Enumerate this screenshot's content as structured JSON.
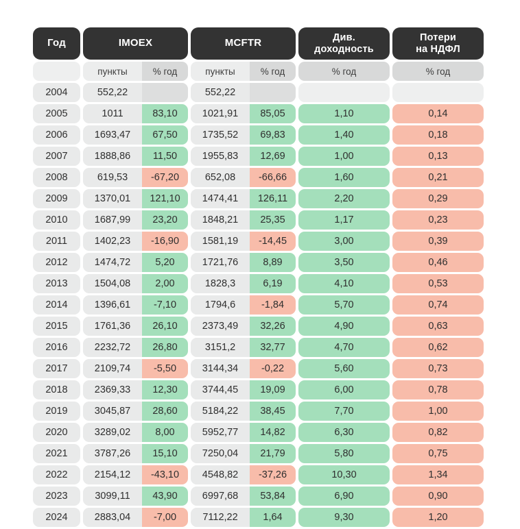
{
  "table": {
    "headers": [
      {
        "label": "Год",
        "sub": ""
      },
      {
        "label": "IMOEX",
        "sub_points": "пункты",
        "sub_pct": "% год"
      },
      {
        "label": "MCFTR",
        "sub_points": "пункты",
        "sub_pct": "% год"
      },
      {
        "label": "Див.\nдоходность",
        "line1": "Див.",
        "line2": "доходность",
        "sub": "% год"
      },
      {
        "label": "Потери\nна НДФЛ",
        "line1": "Потери",
        "line2": "на НДФЛ",
        "sub": "% год"
      }
    ],
    "colors": {
      "header_bg": "#333333",
      "header_text": "#ffffff",
      "cell_bg": "#e9eaea",
      "sub_bg": "#eceded",
      "sub_shade": "#d8d9d9",
      "positive": "#a4dfbb",
      "negative": "#f8bcaa",
      "empty": "#dddede",
      "text": "#2f2f2f",
      "page_bg": "#ffffff"
    },
    "rows": [
      {
        "year": "2004",
        "imoex_pts": "552,22",
        "imoex_pct": "",
        "imoex_sign": "empty",
        "mcftr_pts": "552,22",
        "mcftr_pct": "",
        "mcftr_sign": "empty",
        "div": "",
        "div_sign": "empty",
        "ndfl": "",
        "ndfl_sign": "empty"
      },
      {
        "year": "2005",
        "imoex_pts": "1011",
        "imoex_pct": "83,10",
        "imoex_sign": "pos",
        "mcftr_pts": "1021,91",
        "mcftr_pct": "85,05",
        "mcftr_sign": "pos",
        "div": "1,10",
        "div_sign": "pos",
        "ndfl": "0,14",
        "ndfl_sign": "neg"
      },
      {
        "year": "2006",
        "imoex_pts": "1693,47",
        "imoex_pct": "67,50",
        "imoex_sign": "pos",
        "mcftr_pts": "1735,52",
        "mcftr_pct": "69,83",
        "mcftr_sign": "pos",
        "div": "1,40",
        "div_sign": "pos",
        "ndfl": "0,18",
        "ndfl_sign": "neg"
      },
      {
        "year": "2007",
        "imoex_pts": "1888,86",
        "imoex_pct": "11,50",
        "imoex_sign": "pos",
        "mcftr_pts": "1955,83",
        "mcftr_pct": "12,69",
        "mcftr_sign": "pos",
        "div": "1,00",
        "div_sign": "pos",
        "ndfl": "0,13",
        "ndfl_sign": "neg"
      },
      {
        "year": "2008",
        "imoex_pts": "619,53",
        "imoex_pct": "-67,20",
        "imoex_sign": "neg",
        "mcftr_pts": "652,08",
        "mcftr_pct": "-66,66",
        "mcftr_sign": "neg",
        "div": "1,60",
        "div_sign": "pos",
        "ndfl": "0,21",
        "ndfl_sign": "neg"
      },
      {
        "year": "2009",
        "imoex_pts": "1370,01",
        "imoex_pct": "121,10",
        "imoex_sign": "pos",
        "mcftr_pts": "1474,41",
        "mcftr_pct": "126,11",
        "mcftr_sign": "pos",
        "div": "2,20",
        "div_sign": "pos",
        "ndfl": "0,29",
        "ndfl_sign": "neg"
      },
      {
        "year": "2010",
        "imoex_pts": "1687,99",
        "imoex_pct": "23,20",
        "imoex_sign": "pos",
        "mcftr_pts": "1848,21",
        "mcftr_pct": "25,35",
        "mcftr_sign": "pos",
        "div": "1,17",
        "div_sign": "pos",
        "ndfl": "0,23",
        "ndfl_sign": "neg"
      },
      {
        "year": "2011",
        "imoex_pts": "1402,23",
        "imoex_pct": "-16,90",
        "imoex_sign": "neg",
        "mcftr_pts": "1581,19",
        "mcftr_pct": "-14,45",
        "mcftr_sign": "neg",
        "div": "3,00",
        "div_sign": "pos",
        "ndfl": "0,39",
        "ndfl_sign": "neg"
      },
      {
        "year": "2012",
        "imoex_pts": "1474,72",
        "imoex_pct": "5,20",
        "imoex_sign": "pos",
        "mcftr_pts": "1721,76",
        "mcftr_pct": "8,89",
        "mcftr_sign": "pos",
        "div": "3,50",
        "div_sign": "pos",
        "ndfl": "0,46",
        "ndfl_sign": "neg"
      },
      {
        "year": "2013",
        "imoex_pts": "1504,08",
        "imoex_pct": "2,00",
        "imoex_sign": "pos",
        "mcftr_pts": "1828,3",
        "mcftr_pct": "6,19",
        "mcftr_sign": "pos",
        "div": "4,10",
        "div_sign": "pos",
        "ndfl": "0,53",
        "ndfl_sign": "neg"
      },
      {
        "year": "2014",
        "imoex_pts": "1396,61",
        "imoex_pct": "-7,10",
        "imoex_sign": "pos",
        "mcftr_pts": "1794,6",
        "mcftr_pct": "-1,84",
        "mcftr_sign": "neg",
        "div": "5,70",
        "div_sign": "pos",
        "ndfl": "0,74",
        "ndfl_sign": "neg"
      },
      {
        "year": "2015",
        "imoex_pts": "1761,36",
        "imoex_pct": "26,10",
        "imoex_sign": "pos",
        "mcftr_pts": "2373,49",
        "mcftr_pct": "32,26",
        "mcftr_sign": "pos",
        "div": "4,90",
        "div_sign": "pos",
        "ndfl": "0,63",
        "ndfl_sign": "neg"
      },
      {
        "year": "2016",
        "imoex_pts": "2232,72",
        "imoex_pct": "26,80",
        "imoex_sign": "pos",
        "mcftr_pts": "3151,2",
        "mcftr_pct": "32,77",
        "mcftr_sign": "pos",
        "div": "4,70",
        "div_sign": "pos",
        "ndfl": "0,62",
        "ndfl_sign": "neg"
      },
      {
        "year": "2017",
        "imoex_pts": "2109,74",
        "imoex_pct": "-5,50",
        "imoex_sign": "neg",
        "mcftr_pts": "3144,34",
        "mcftr_pct": "-0,22",
        "mcftr_sign": "neg",
        "div": "5,60",
        "div_sign": "pos",
        "ndfl": "0,73",
        "ndfl_sign": "neg"
      },
      {
        "year": "2018",
        "imoex_pts": "2369,33",
        "imoex_pct": "12,30",
        "imoex_sign": "pos",
        "mcftr_pts": "3744,45",
        "mcftr_pct": "19,09",
        "mcftr_sign": "pos",
        "div": "6,00",
        "div_sign": "pos",
        "ndfl": "0,78",
        "ndfl_sign": "neg"
      },
      {
        "year": "2019",
        "imoex_pts": "3045,87",
        "imoex_pct": "28,60",
        "imoex_sign": "pos",
        "mcftr_pts": "5184,22",
        "mcftr_pct": "38,45",
        "mcftr_sign": "pos",
        "div": "7,70",
        "div_sign": "pos",
        "ndfl": "1,00",
        "ndfl_sign": "neg"
      },
      {
        "year": "2020",
        "imoex_pts": "3289,02",
        "imoex_pct": "8,00",
        "imoex_sign": "pos",
        "mcftr_pts": "5952,77",
        "mcftr_pct": "14,82",
        "mcftr_sign": "pos",
        "div": "6,30",
        "div_sign": "pos",
        "ndfl": "0,82",
        "ndfl_sign": "neg"
      },
      {
        "year": "2021",
        "imoex_pts": "3787,26",
        "imoex_pct": "15,10",
        "imoex_sign": "pos",
        "mcftr_pts": "7250,04",
        "mcftr_pct": "21,79",
        "mcftr_sign": "pos",
        "div": "5,80",
        "div_sign": "pos",
        "ndfl": "0,75",
        "ndfl_sign": "neg"
      },
      {
        "year": "2022",
        "imoex_pts": "2154,12",
        "imoex_pct": "-43,10",
        "imoex_sign": "neg",
        "mcftr_pts": "4548,82",
        "mcftr_pct": "-37,26",
        "mcftr_sign": "neg",
        "div": "10,30",
        "div_sign": "pos",
        "ndfl": "1,34",
        "ndfl_sign": "neg"
      },
      {
        "year": "2023",
        "imoex_pts": "3099,11",
        "imoex_pct": "43,90",
        "imoex_sign": "pos",
        "mcftr_pts": "6997,68",
        "mcftr_pct": "53,84",
        "mcftr_sign": "pos",
        "div": "6,90",
        "div_sign": "pos",
        "ndfl": "0,90",
        "ndfl_sign": "neg"
      },
      {
        "year": "2024",
        "imoex_pts": "2883,04",
        "imoex_pct": "-7,00",
        "imoex_sign": "neg",
        "mcftr_pts": "7112,22",
        "mcftr_pct": "1,64",
        "mcftr_sign": "pos",
        "div": "9,30",
        "div_sign": "pos",
        "ndfl": "1,20",
        "ndfl_sign": "neg"
      }
    ]
  },
  "chart_data": {
    "type": "table",
    "title": "",
    "columns": [
      "Год",
      "IMOEX пункты",
      "IMOEX % год",
      "MCFTR пункты",
      "MCFTR % год",
      "Див. доходность % год",
      "Потери на НДФЛ % год"
    ],
    "x": [
      "2004",
      "2005",
      "2006",
      "2007",
      "2008",
      "2009",
      "2010",
      "2011",
      "2012",
      "2013",
      "2014",
      "2015",
      "2016",
      "2017",
      "2018",
      "2019",
      "2020",
      "2021",
      "2022",
      "2023",
      "2024"
    ],
    "series": [
      {
        "name": "IMOEX пункты",
        "values": [
          552.22,
          1011,
          1693.47,
          1888.86,
          619.53,
          1370.01,
          1687.99,
          1402.23,
          1474.72,
          1504.08,
          1396.61,
          1761.36,
          2232.72,
          2109.74,
          2369.33,
          3045.87,
          3289.02,
          3787.26,
          2154.12,
          3099.11,
          2883.04
        ]
      },
      {
        "name": "IMOEX % год",
        "values": [
          null,
          83.1,
          67.5,
          11.5,
          -67.2,
          121.1,
          23.2,
          -16.9,
          5.2,
          2.0,
          -7.1,
          26.1,
          26.8,
          -5.5,
          12.3,
          28.6,
          8.0,
          15.1,
          -43.1,
          43.9,
          -7.0
        ]
      },
      {
        "name": "MCFTR пункты",
        "values": [
          552.22,
          1021.91,
          1735.52,
          1955.83,
          652.08,
          1474.41,
          1848.21,
          1581.19,
          1721.76,
          1828.3,
          1794.6,
          2373.49,
          3151.2,
          3144.34,
          3744.45,
          5184.22,
          5952.77,
          7250.04,
          4548.82,
          6997.68,
          7112.22
        ]
      },
      {
        "name": "MCFTR % год",
        "values": [
          null,
          85.05,
          69.83,
          12.69,
          -66.66,
          126.11,
          25.35,
          -14.45,
          8.89,
          6.19,
          -1.84,
          32.26,
          32.77,
          -0.22,
          19.09,
          38.45,
          14.82,
          21.79,
          -37.26,
          53.84,
          1.64
        ]
      },
      {
        "name": "Див. доходность % год",
        "values": [
          null,
          1.1,
          1.4,
          1.0,
          1.6,
          2.2,
          1.17,
          3.0,
          3.5,
          4.1,
          5.7,
          4.9,
          4.7,
          5.6,
          6.0,
          7.7,
          6.3,
          5.8,
          10.3,
          6.9,
          9.3
        ]
      },
      {
        "name": "Потери на НДФЛ % год",
        "values": [
          null,
          0.14,
          0.18,
          0.13,
          0.21,
          0.29,
          0.23,
          0.39,
          0.46,
          0.53,
          0.74,
          0.63,
          0.62,
          0.73,
          0.78,
          1.0,
          0.82,
          0.75,
          1.34,
          0.9,
          1.2
        ]
      }
    ]
  }
}
